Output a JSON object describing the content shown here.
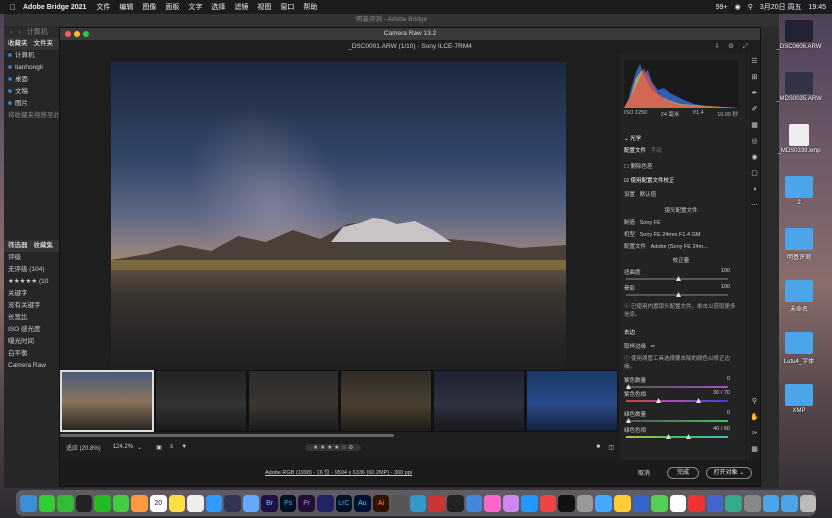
{
  "menubar": {
    "app": "Adobe Bridge 2021",
    "items": [
      "文件",
      "编辑",
      "图像",
      "面板",
      "文字",
      "选择",
      "滤镜",
      "视图",
      "窗口",
      "帮助"
    ],
    "battery": "99+",
    "date": "3月20日 周五",
    "time": "19:45"
  },
  "bridge": {
    "title": "明基评测 - Adobe Bridge",
    "toolbar_computer": "计算机",
    "side_tabs": [
      "收藏夹",
      "文件夹"
    ],
    "fav": [
      "计算机",
      "tianhongli",
      "桌面",
      "文稿",
      "图片"
    ],
    "fav_hint": "将收藏夹拖移至此",
    "filter_tabs": [
      "筛选器",
      "收藏集"
    ],
    "filter_items": [
      "评级",
      "无评级 (104)",
      "★★★★★ (10",
      "关键字",
      "没有关键字",
      "长宽比",
      "ISO 感光度",
      "曝光时间",
      "白平衡",
      "Camera Raw"
    ]
  },
  "cr": {
    "window_title": "Camera Raw 13.2",
    "file_header": "_DSC0001.ARW (1/10)  ·  Sony ILCE-7RM4",
    "hist_info": [
      "ISO 1250",
      "24 毫米",
      "f/1.4",
      "10.00 秒"
    ],
    "profile": {
      "header": "光学",
      "tab1": "配置文件",
      "tab2": "手动",
      "remove_chroma": "删除色差",
      "use_profile": "使用配置文件校正",
      "setup_label": "设置",
      "setup_value": "默认值",
      "lens_header": "镜头配置文件",
      "make_label": "制造",
      "make_value": "Sony FE",
      "model_label": "机型",
      "model_value": "Sony FE 24mm F1.4 GM",
      "prof_label": "配置文件",
      "prof_value": "Adobe (Sony FE 24m...",
      "amount_header": "校正量",
      "distortion_label": "扭曲度",
      "distortion_value": "100",
      "vignette_label": "晕影",
      "vignette_value": "100",
      "note": "已使用内置镜头配置文件。单击以获取更多信息。"
    },
    "defringe": {
      "header": "去边",
      "fringe_label": "取样边缘",
      "note": "使用滴管工具选择要去除的颜色以修正边缘。",
      "purple_amount_label": "紫色数量",
      "purple_amount_value": "0",
      "purple_hue_label": "紫色色相",
      "purple_hue_value": "30 / 70",
      "green_amount_label": "绿色数量",
      "green_amount_value": "0",
      "green_hue_label": "绿色色相",
      "green_hue_value": "40 / 60"
    },
    "status": {
      "fit": "适应 (20.8%)",
      "zoom": "124.2%"
    },
    "footer": {
      "info": "Adobe RGB (1998) - 16 位 - 9504 x 6336 (60.2MP) - 300 ppi",
      "cancel": "取消",
      "done": "完成",
      "open": "打开对象"
    }
  },
  "desktop": [
    {
      "label": "_DSC0606.ARW"
    },
    {
      "label": "_MDS0035.ARW"
    },
    {
      "label": "_MDS0339.xmp"
    },
    {
      "label": "2"
    },
    {
      "label": "明基评测"
    },
    {
      "label": "未命名"
    },
    {
      "label": "Lutu4_字体"
    },
    {
      "label": "XMP"
    }
  ],
  "colors": {
    "accent": "#3a8fd8",
    "folder": "#4aa6e8"
  }
}
